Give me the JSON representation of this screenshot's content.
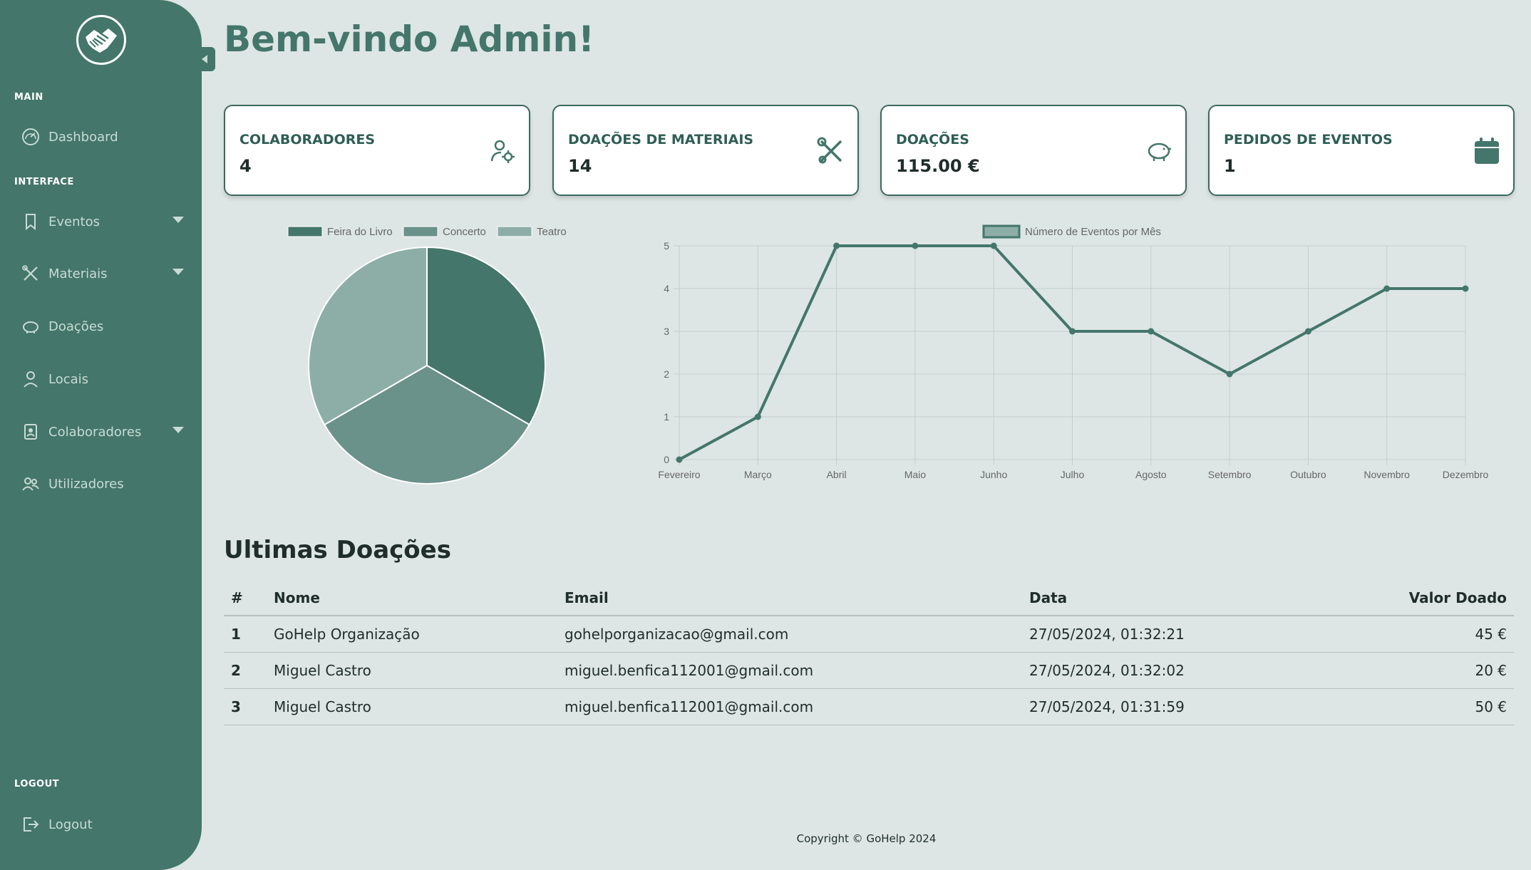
{
  "sidebar": {
    "sections": [
      "MAIN",
      "INTERFACE",
      "LOGOUT"
    ],
    "items": [
      {
        "label": "Dashboard"
      },
      {
        "label": "Eventos"
      },
      {
        "label": "Materiais"
      },
      {
        "label": "Doações"
      },
      {
        "label": "Locais"
      },
      {
        "label": "Colaboradores"
      },
      {
        "label": "Utilizadores"
      },
      {
        "label": "Logout"
      }
    ]
  },
  "header": {
    "title": "Bem-vindo Admin!"
  },
  "cards": [
    {
      "title": "COLABORADORES",
      "value": "4",
      "icon": "user-gear-icon"
    },
    {
      "title": "DOAÇÕES DE MATERIAIS",
      "value": "14",
      "icon": "tools-icon"
    },
    {
      "title": "DOAÇÕES",
      "value": "115.00 €",
      "icon": "piggy-bank-icon"
    },
    {
      "title": "PEDIDOS DE EVENTOS",
      "value": "1",
      "icon": "calendar-icon"
    }
  ],
  "colors": {
    "accent": "#44766b",
    "pie": [
      "#44766b",
      "#6a918a",
      "#8daea7"
    ]
  },
  "chart_data": [
    {
      "type": "pie",
      "categories": [
        "Feira do Livro",
        "Concerto",
        "Teatro"
      ],
      "values": [
        1,
        1,
        1
      ],
      "legend": "top"
    },
    {
      "type": "line",
      "categories": [
        "Fevereiro",
        "Março",
        "Abril",
        "Maio",
        "Junho",
        "Julho",
        "Agosto",
        "Setembro",
        "Outubro",
        "Novembro",
        "Dezembro"
      ],
      "series": [
        {
          "name": "Número de Eventos por Mês",
          "values": [
            0,
            1,
            5,
            5,
            5,
            3,
            3,
            2,
            3,
            4,
            4
          ]
        }
      ],
      "ylim": [
        0,
        5
      ],
      "yticks": [
        "0",
        "1",
        "2",
        "3",
        "4",
        "5"
      ],
      "grid": true,
      "legend": "top"
    }
  ],
  "donations": {
    "title": "Ultimas Doações",
    "columns": [
      "#",
      "Nome",
      "Email",
      "Data",
      "Valor Doado"
    ],
    "rows": [
      {
        "n": "1",
        "nome": "GoHelp Organização",
        "email": "gohelporganizacao@gmail.com",
        "data": "27/05/2024, 01:32:21",
        "valor": "45 €"
      },
      {
        "n": "2",
        "nome": "Miguel Castro",
        "email": "miguel.benfica112001@gmail.com",
        "data": "27/05/2024, 01:32:02",
        "valor": "20 €"
      },
      {
        "n": "3",
        "nome": "Miguel Castro",
        "email": "miguel.benfica112001@gmail.com",
        "data": "27/05/2024, 01:31:59",
        "valor": "50 €"
      }
    ]
  },
  "footer": {
    "text": "Copyright © GoHelp 2024"
  }
}
